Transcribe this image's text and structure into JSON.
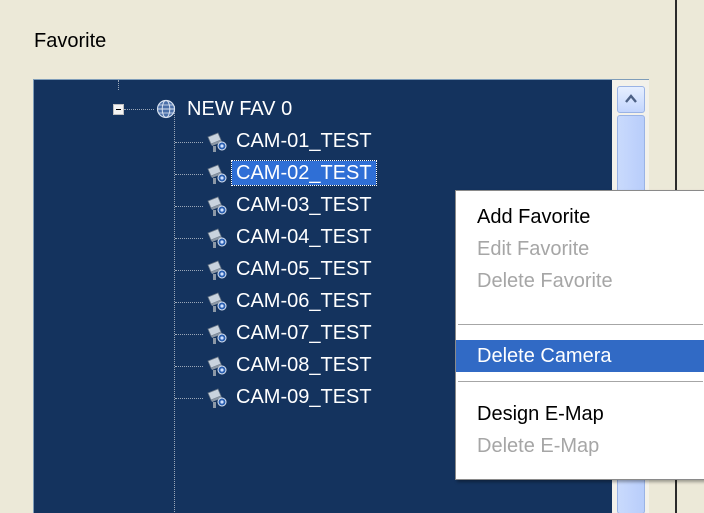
{
  "panel": {
    "title": "Favorite"
  },
  "tree": {
    "root": {
      "label": "NEW FAV 0",
      "expanded": true
    },
    "cameras": [
      {
        "label": "CAM-01_TEST",
        "selected": false
      },
      {
        "label": "CAM-02_TEST",
        "selected": true
      },
      {
        "label": "CAM-03_TEST",
        "selected": false
      },
      {
        "label": "CAM-04_TEST",
        "selected": false
      },
      {
        "label": "CAM-05_TEST",
        "selected": false
      },
      {
        "label": "CAM-06_TEST",
        "selected": false
      },
      {
        "label": "CAM-07_TEST",
        "selected": false
      },
      {
        "label": "CAM-08_TEST",
        "selected": false
      },
      {
        "label": "CAM-09_TEST",
        "selected": false
      }
    ]
  },
  "context_menu": {
    "items": [
      {
        "label": "Add Favorite",
        "enabled": true
      },
      {
        "label": "Edit Favorite",
        "enabled": false
      },
      {
        "label": "Delete Favorite",
        "enabled": false
      },
      {
        "label": "Delete Camera",
        "enabled": true,
        "highlighted": true
      },
      {
        "label": "Design E-Map",
        "enabled": true
      },
      {
        "label": "Delete E-Map",
        "enabled": false
      }
    ]
  },
  "colors": {
    "tree_background": "#14335e",
    "selection": "#2f6fd6",
    "menu_highlight": "#316ac5",
    "disabled_text": "#a6a6a6"
  }
}
